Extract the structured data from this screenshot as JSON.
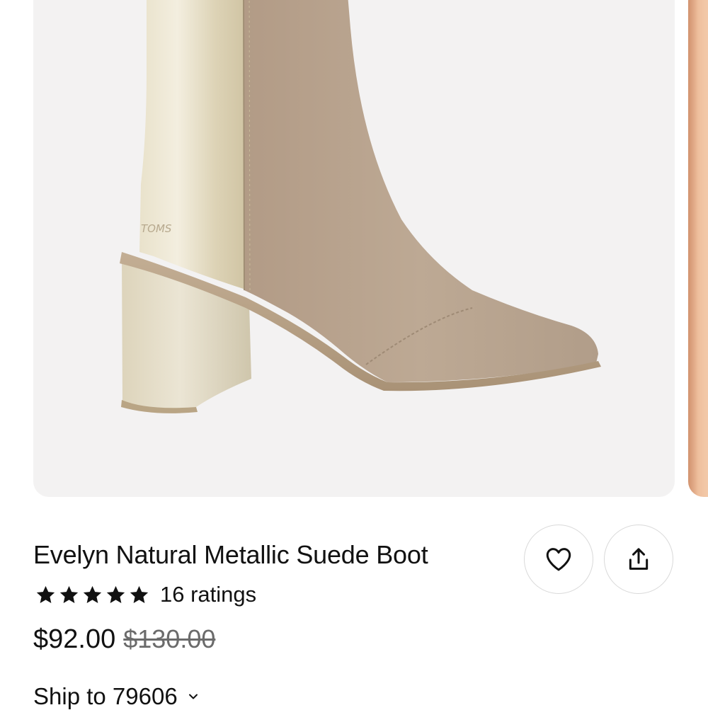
{
  "product": {
    "title": "Evelyn Natural Metallic Suede Boot",
    "brand_mark": "TOMS",
    "rating": {
      "stars": 5,
      "count_text": "16 ratings"
    },
    "price": "$92.00",
    "original_price": "$130.00"
  },
  "actions": {
    "favorite_icon": "heart-icon",
    "share_icon": "share-icon"
  },
  "shipping": {
    "label": "Ship to 79606"
  },
  "colors": {
    "image_background": "#f3f2f2",
    "suede": "#b8a38f",
    "metallic": "#e6ddc2",
    "text": "#111111",
    "muted_text": "#6b6b6b",
    "star": "#111111"
  }
}
